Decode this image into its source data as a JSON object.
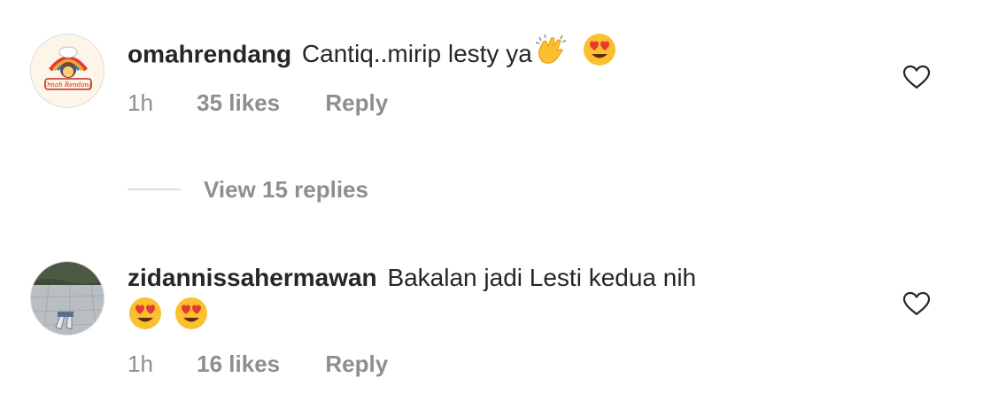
{
  "comments": [
    {
      "username": "omahrendang",
      "text": "Cantiq..mirip lesty ya",
      "emojis": [
        "clapping-hands-emoji",
        "heart-eyes-emoji"
      ],
      "time": "1h",
      "likes": "35 likes",
      "reply": "Reply",
      "avatar_logo_text": "Omah Rendang"
    },
    {
      "username": "zidannissahermawan",
      "text": "Bakalan jadi Lesti kedua nih",
      "emojis": [
        "heart-eyes-emoji",
        "heart-eyes-emoji"
      ],
      "time": "1h",
      "likes": "16 likes",
      "reply": "Reply"
    }
  ],
  "view_replies": "View 15 replies",
  "colors": {
    "primary_text": "#262626",
    "secondary_text": "#8e8e8e",
    "divider": "#dbdbdb",
    "emoji_face": "#fbc02d",
    "emoji_heart": "#e53935"
  },
  "icons": {
    "like": "heart-outline-icon"
  }
}
